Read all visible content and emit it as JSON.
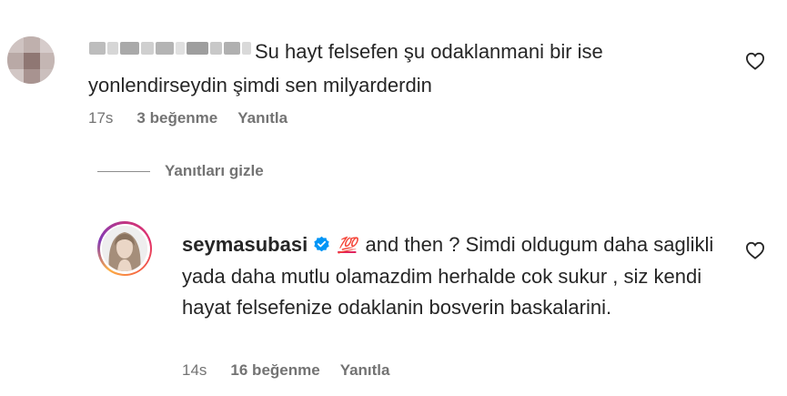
{
  "comment1": {
    "text": "Su hayt felsefen şu odaklanmani bir ise yonlendirseydin şimdi sen milyarderdin",
    "time": "17s",
    "likes": "3 beğenme",
    "reply_label": "Yanıtla"
  },
  "replies_toggle": {
    "label": "Yanıtları gizle"
  },
  "comment2": {
    "username": "seymasubasi",
    "emoji": "💯",
    "text": "and then ? Simdi oldugum daha saglikli yada daha mutlu olamazdim herhalde cok sukur , siz kendi hayat felsefenize odaklanin bosverin baskalarini.",
    "time": "14s",
    "likes": "16 beğenme",
    "reply_label": "Yanıtla"
  },
  "icons": {
    "like": "heart-outline-icon",
    "verified": "verified-badge-icon"
  },
  "colors": {
    "text": "#262626",
    "meta": "#737373",
    "verified": "#0095f6",
    "story_ring": "#e1306c"
  }
}
